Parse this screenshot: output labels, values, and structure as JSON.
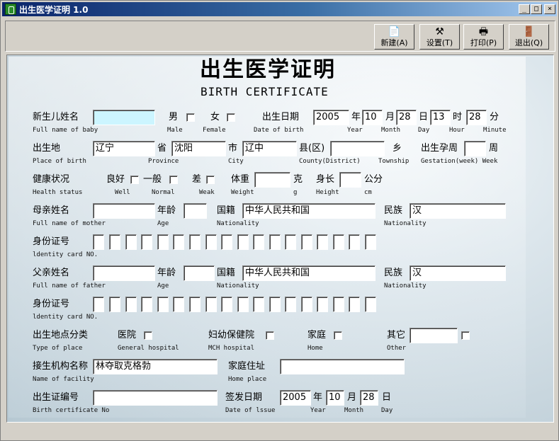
{
  "window": {
    "title": "出生医学证明 1.0",
    "min": "_",
    "max": "□",
    "close": "×"
  },
  "toolbar": {
    "new_label": "新建(A)",
    "settings_label": "设置(T)",
    "print_label": "打印(P)",
    "exit_label": "退出(Q)"
  },
  "header": {
    "title_cn": "出生医学证明",
    "title_en": "BIRTH CERTIFICATE"
  },
  "baby": {
    "name_cn": "新生儿姓名",
    "name_en": "Full name of baby",
    "name_value": "",
    "male_cn": "男",
    "male_en": "Male",
    "female_cn": "女",
    "female_en": "Female",
    "dob_cn": "出生日期",
    "dob_en": "Date of birth",
    "year_value": "2005",
    "year_cn": "年",
    "year_en": "Year",
    "month_value": "10",
    "month_cn": "月",
    "month_en": "Month",
    "day_value": "28",
    "day_cn": "日",
    "day_en": "Day",
    "hour_value": "13",
    "hour_cn": "时",
    "hour_en": "Hour",
    "minute_value": "28",
    "minute_cn": "分",
    "minute_en": "Minute"
  },
  "place": {
    "label_cn": "出生地",
    "label_en": "Place of birth",
    "province_value": "辽宁",
    "province_cn": "省",
    "province_en": "Province",
    "city_value": "沈阳",
    "city_cn": "市",
    "city_en": "City",
    "county_value": "辽中",
    "county_cn": "县(区)",
    "county_en": "County(District)",
    "township_value": "",
    "township_cn": "乡",
    "township_en": "Township",
    "gestation_cn": "出生孕周",
    "gestation_value": "",
    "gestation_unit_cn": "周",
    "gestation_en": "Gestation(week) Week"
  },
  "health": {
    "label_cn": "健康状况",
    "label_en": "Health status",
    "well_cn": "良好",
    "well_en": "Well",
    "normal_cn": "一般",
    "normal_en": "Normal",
    "weak_cn": "差",
    "weak_en": "Weak",
    "weight_cn": "体重",
    "weight_en": "Weight",
    "weight_value": "",
    "weight_unit_cn": "克",
    "weight_unit_en": "g",
    "height_cn": "身长",
    "height_en": "Height",
    "height_value": "",
    "height_unit_cn": "公分",
    "height_unit_en": "cm"
  },
  "mother": {
    "name_cn": "母亲姓名",
    "name_en": "Full name of mother",
    "name_value": "",
    "age_cn": "年龄",
    "age_en": "Age",
    "age_value": "",
    "nationality_cn": "国籍",
    "nationality_en": "Nationality",
    "nationality_value": "中华人民共和国",
    "ethnic_cn": "民族",
    "ethnic_en": "Nationality",
    "ethnic_value": "汉",
    "id_cn": "身份证号",
    "id_en": "ldentity card NO."
  },
  "father": {
    "name_cn": "父亲姓名",
    "name_en": "Full name of father",
    "name_value": "",
    "age_cn": "年龄",
    "age_en": "Age",
    "age_value": "",
    "nationality_cn": "国籍",
    "nationality_en": "Nationality",
    "nationality_value": "中华人民共和国",
    "ethnic_cn": "民族",
    "ethnic_en": "Nationality",
    "ethnic_value": "汉",
    "id_cn": "身份证号",
    "id_en": "ldentity card NO."
  },
  "place_type": {
    "label_cn": "出生地点分类",
    "label_en": "Type of place",
    "general_cn": "医院",
    "general_en": "General hospital",
    "mch_cn": "妇幼保健院",
    "mch_en": "MCH hospital",
    "home_cn": "家庭",
    "home_en": "Home",
    "other_cn": "其它",
    "other_en": "Other",
    "other_value": ""
  },
  "facility": {
    "label_cn": "接生机构名称",
    "label_en": "Name of facility",
    "value": "林夺取克格勃",
    "home_cn": "家庭住址",
    "home_en": "Home place",
    "home_value": ""
  },
  "certificate": {
    "no_cn": "出生证编号",
    "no_en": "Birth certificate No",
    "no_value": "",
    "issue_cn": "签发日期",
    "issue_en": "Date of lssue",
    "year_value": "2005",
    "year_cn": "年",
    "year_en": "Year",
    "month_value": "10",
    "month_cn": "月",
    "month_en": "Month",
    "day_value": "28",
    "day_cn": "日",
    "day_en": "Day"
  }
}
